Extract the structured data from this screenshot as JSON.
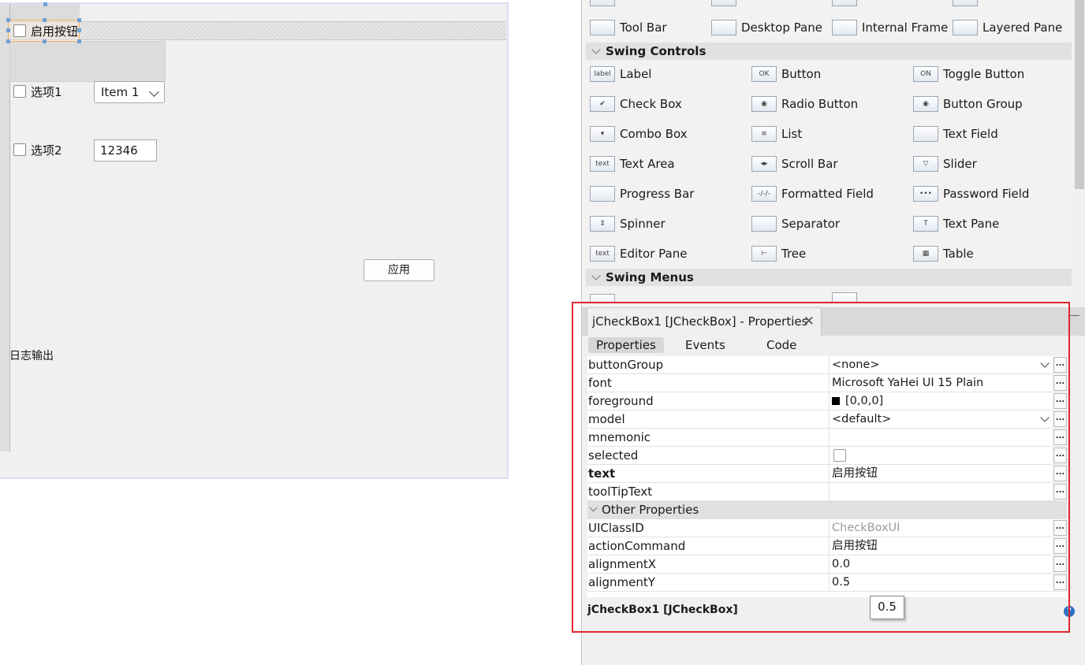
{
  "designer": {
    "checkbox_enable": "启用按钮",
    "checkbox_option1": "选项1",
    "checkbox_option2": "选项2",
    "combo_value": "Item 1",
    "number_value": "12346",
    "apply_button": "应用",
    "log_label": "日志输出"
  },
  "palette": {
    "sections": {
      "controls": "Swing Controls",
      "menus": "Swing Menus"
    },
    "containers": [
      {
        "label": "Tool Bar",
        "icon": "tool-bar-icon"
      },
      {
        "label": "Desktop Pane",
        "icon": "desktop-pane-icon"
      },
      {
        "label": "Internal Frame",
        "icon": "internal-frame-icon"
      },
      {
        "label": "Layered Pane",
        "icon": "layered-pane-icon"
      }
    ],
    "controls": [
      {
        "label": "Label",
        "icon": "label-icon",
        "glyph": "label"
      },
      {
        "label": "Button",
        "icon": "button-icon",
        "glyph": "OK"
      },
      {
        "label": "Toggle Button",
        "icon": "toggle-button-icon",
        "glyph": "ON"
      },
      {
        "label": "Check Box",
        "icon": "check-box-icon",
        "glyph": "✔"
      },
      {
        "label": "Radio Button",
        "icon": "radio-button-icon",
        "glyph": "◉"
      },
      {
        "label": "Button Group",
        "icon": "button-group-icon",
        "glyph": "◉"
      },
      {
        "label": "Combo Box",
        "icon": "combo-box-icon",
        "glyph": "▾"
      },
      {
        "label": "List",
        "icon": "list-icon",
        "glyph": "≡"
      },
      {
        "label": "Text Field",
        "icon": "text-field-icon",
        "glyph": ""
      },
      {
        "label": "Text Area",
        "icon": "text-area-icon",
        "glyph": "text"
      },
      {
        "label": "Scroll Bar",
        "icon": "scroll-bar-icon",
        "glyph": "◂▸"
      },
      {
        "label": "Slider",
        "icon": "slider-icon",
        "glyph": "▽"
      },
      {
        "label": "Progress Bar",
        "icon": "progress-bar-icon",
        "glyph": ""
      },
      {
        "label": "Formatted Field",
        "icon": "formatted-field-icon",
        "glyph": "-/-/-"
      },
      {
        "label": "Password Field",
        "icon": "password-field-icon",
        "glyph": "•••"
      },
      {
        "label": "Spinner",
        "icon": "spinner-icon",
        "glyph": "⇕"
      },
      {
        "label": "Separator",
        "icon": "separator-icon",
        "glyph": ""
      },
      {
        "label": "Text Pane",
        "icon": "text-pane-icon",
        "glyph": "T"
      },
      {
        "label": "Editor Pane",
        "icon": "editor-pane-icon",
        "glyph": "text"
      },
      {
        "label": "Tree",
        "icon": "tree-icon",
        "glyph": "⊢"
      },
      {
        "label": "Table",
        "icon": "table-icon",
        "glyph": "▦"
      }
    ]
  },
  "properties": {
    "tab_title": "jCheckBox1 [JCheckBox] - Properties",
    "subtabs": [
      "Properties",
      "Events",
      "Code"
    ],
    "rows": [
      {
        "name": "buttonGroup",
        "value": "<none>"
      },
      {
        "name": "font",
        "value": "Microsoft YaHei UI 15 Plain"
      },
      {
        "name": "foreground",
        "value": "[0,0,0]"
      },
      {
        "name": "model",
        "value": "<default>"
      },
      {
        "name": "mnemonic",
        "value": ""
      },
      {
        "name": "selected",
        "value": ""
      },
      {
        "name": "text",
        "value": "启用按钮"
      },
      {
        "name": "toolTipText",
        "value": ""
      }
    ],
    "other_group": "Other Properties",
    "other_rows": [
      {
        "name": "UIClassID",
        "value": "CheckBoxUI"
      },
      {
        "name": "actionCommand",
        "value": "启用按钮"
      },
      {
        "name": "alignmentX",
        "value": "0.0"
      },
      {
        "name": "alignmentY",
        "value": "0.5"
      }
    ],
    "ellipsis": "...",
    "footer": "jCheckBox1 [JCheckBox]",
    "tooltip": "0.5",
    "help": "?"
  }
}
